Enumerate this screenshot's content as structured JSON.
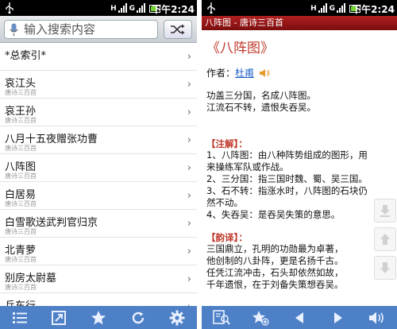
{
  "status": {
    "time": "下午2:24"
  },
  "left": {
    "search": {
      "placeholder": "输入搜索内容"
    },
    "items": [
      {
        "title": "*总索引*",
        "sub": ""
      },
      {
        "title": "哀江头",
        "sub": "唐诗三百首"
      },
      {
        "title": "哀王孙",
        "sub": "唐诗三百首"
      },
      {
        "title": "八月十五夜赠张功曹",
        "sub": "唐诗三百首"
      },
      {
        "title": "八阵图",
        "sub": "唐诗三百首"
      },
      {
        "title": "白居易",
        "sub": "唐诗三百首"
      },
      {
        "title": "白雪歌送武判官归京",
        "sub": "唐诗三百首"
      },
      {
        "title": "北青萝",
        "sub": "唐诗三百首"
      },
      {
        "title": "别房太尉墓",
        "sub": "唐诗三百首"
      },
      {
        "title": "兵车行",
        "sub": ""
      }
    ],
    "toolbar": [
      "list-icon",
      "open-external-icon",
      "star-icon",
      "refresh-icon",
      "gear-icon"
    ]
  },
  "right": {
    "titlebar": "八阵图 - 唐诗三百首",
    "poem_title": "《八阵图》",
    "author_label": "作者：",
    "author_name": "杜甫",
    "body": [
      "功盖三分国，名成八阵图。",
      "江流石不转，遗恨失吞吴。"
    ],
    "notes_head": "【注解】：",
    "notes": [
      "1、八阵图：由八种阵势组成的图形，用来操练军队或作战。",
      "2、三分国：指三国时魏、蜀、吴三国。",
      "3、石不转：指涨水时，八阵图的石块仍然不动。",
      "4、失吞吴：是吞吴失策的意思。"
    ],
    "trans_head": "【韵译】：",
    "trans": [
      "三国鼎立，孔明的功勋最为卓著，",
      "他创制的八卦阵，更是名扬千古。",
      "任凭江流冲击，石头却依然如故，",
      "千年遗恨，在于刘备失策想吞吴。"
    ],
    "toolbar": [
      "search-text-icon",
      "add-favorite-icon",
      "prev-icon",
      "next-icon",
      "sound-icon"
    ]
  },
  "colors": {
    "accent": "#4d80c6",
    "title_red": "#c0392b",
    "titlebar": "#9a1515"
  }
}
